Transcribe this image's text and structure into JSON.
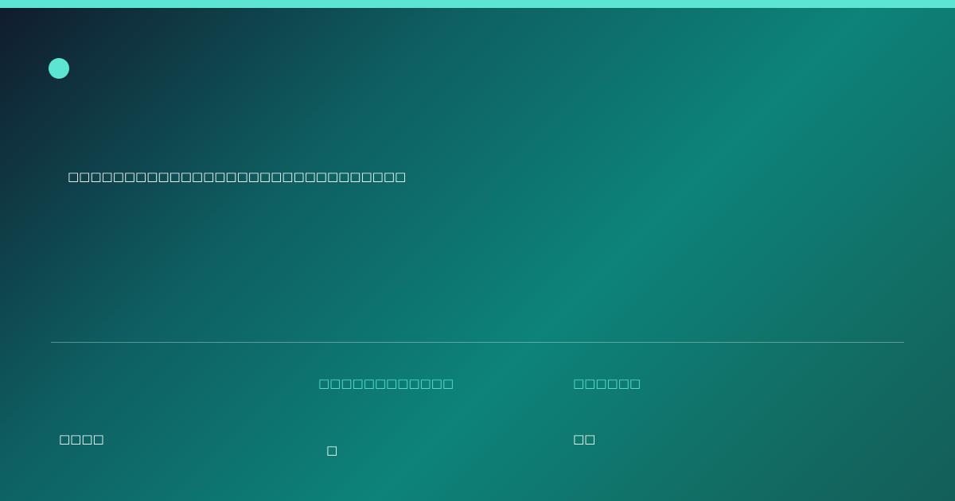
{
  "accent_color": "#5ce6d1",
  "background_colors": [
    "#111a2c",
    "#0e5f61",
    "#0d8379",
    "#135e58"
  ],
  "logo": {
    "icon": "circle-logo-icon"
  },
  "headline": {
    "text": "□□□□□□□□□□□□□□□□□□□□□□□□□□□□□□"
  },
  "stats": {
    "left": {
      "value": "□□□□"
    },
    "middle": {
      "label": "□□□□□□□□□□□□",
      "value": "□"
    },
    "right": {
      "label": "□□□□□□",
      "value": "□□"
    }
  }
}
